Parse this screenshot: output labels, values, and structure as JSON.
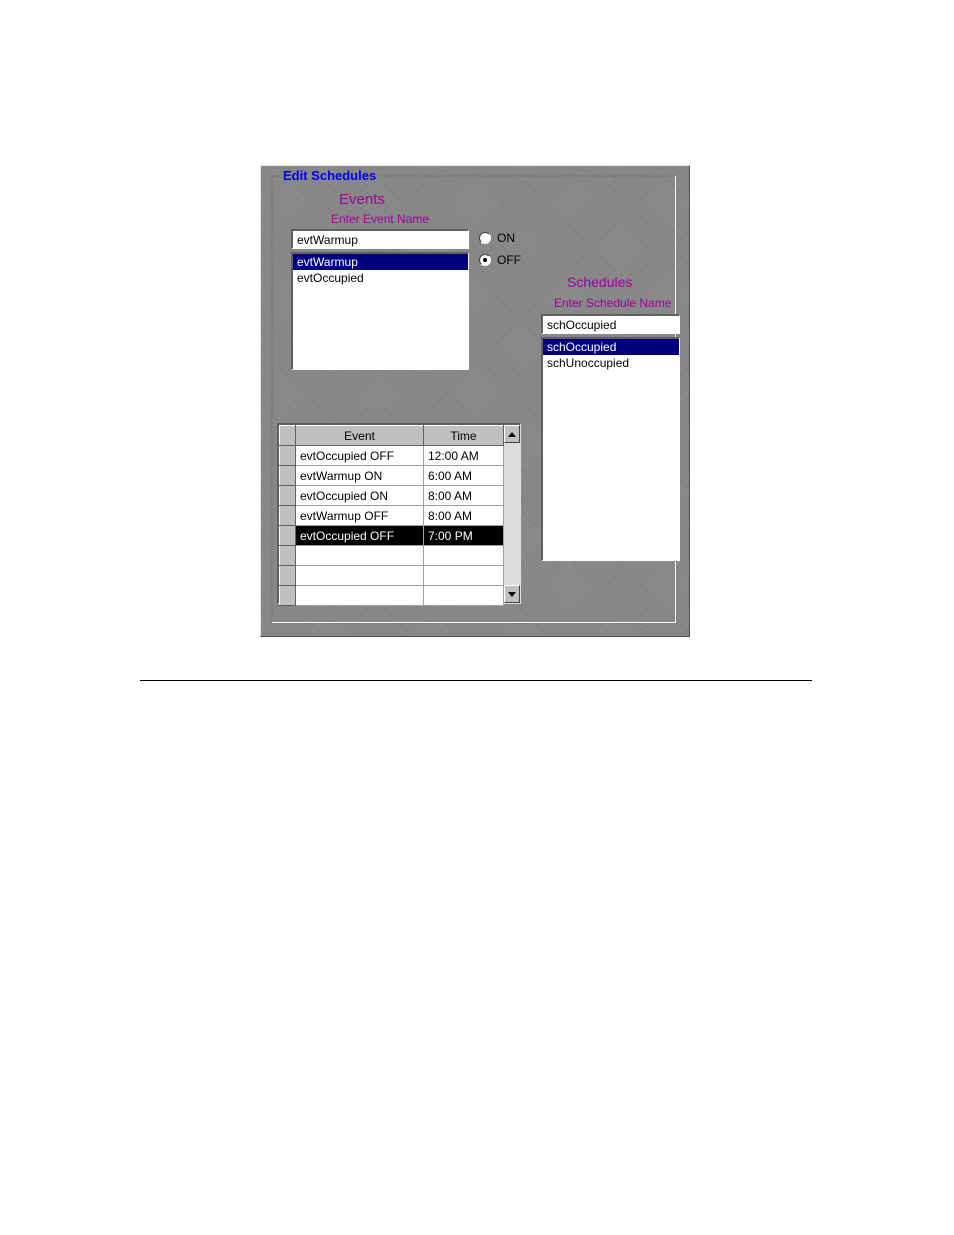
{
  "fieldset": {
    "title": "Edit Schedules"
  },
  "events": {
    "heading": "Events",
    "label": "Enter Event Name",
    "input_value": "evtWarmup",
    "items": [
      "evtWarmup",
      "evtOccupied"
    ],
    "selected_index": 0
  },
  "radios": {
    "on_label": "ON",
    "off_label": "OFF",
    "selected": "OFF"
  },
  "schedules": {
    "heading": "Schedules",
    "label": "Enter Schedule Name",
    "input_value": "schOccupied",
    "items": [
      "schOccupied",
      "schUnoccupied"
    ],
    "selected_index": 0
  },
  "grid": {
    "columns": [
      "Event",
      "Time"
    ],
    "rows": [
      {
        "event": "evtOccupied OFF",
        "time": "12:00 AM"
      },
      {
        "event": "evtWarmup ON",
        "time": "6:00 AM"
      },
      {
        "event": "evtOccupied ON",
        "time": "8:00 AM"
      },
      {
        "event": "evtWarmup OFF",
        "time": "8:00 AM"
      },
      {
        "event": "evtOccupied OFF",
        "time": "7:00 PM"
      },
      {
        "event": "",
        "time": ""
      },
      {
        "event": "",
        "time": ""
      },
      {
        "event": "",
        "time": ""
      }
    ],
    "selected_index": 4
  }
}
